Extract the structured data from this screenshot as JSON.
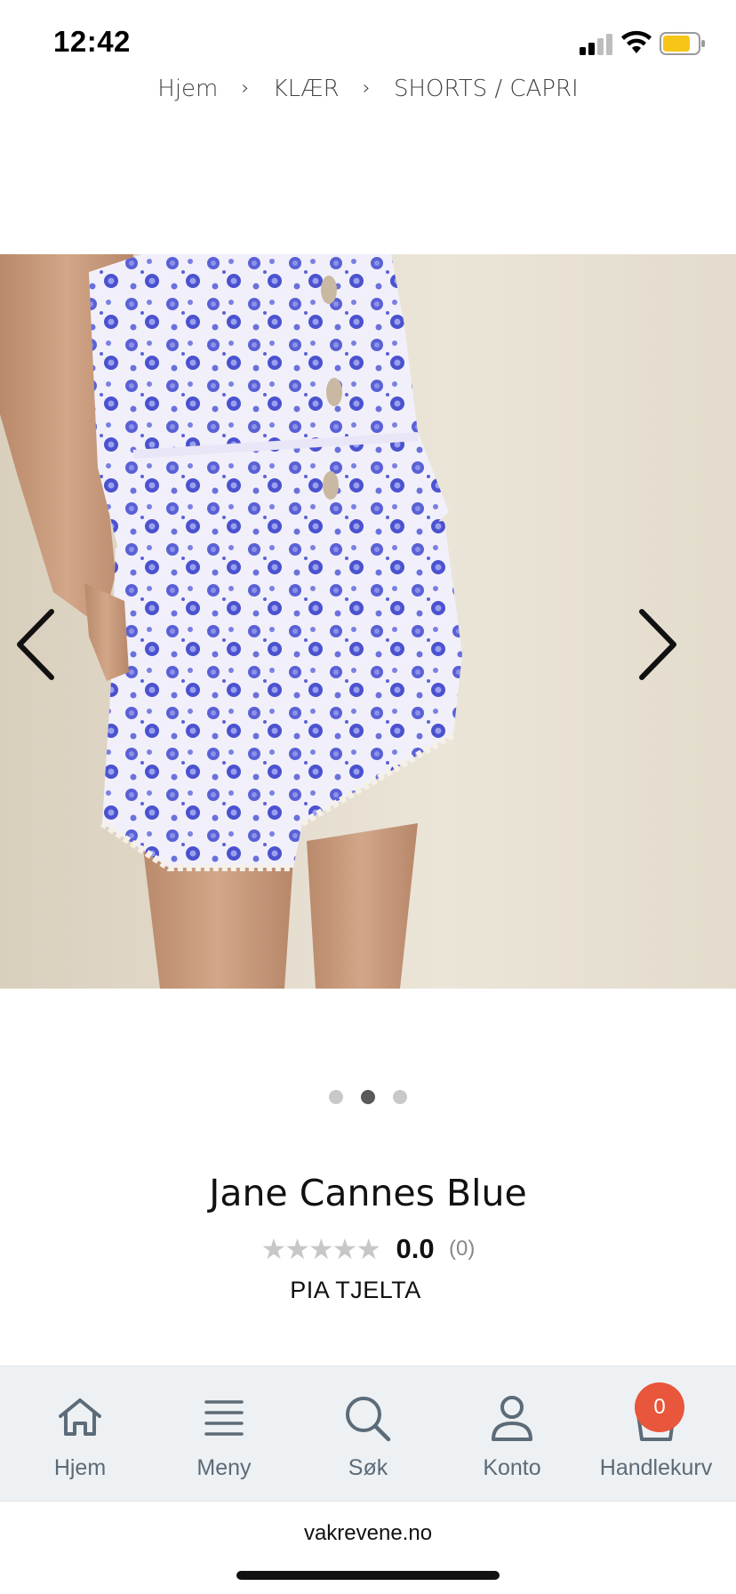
{
  "status": {
    "time": "12:42"
  },
  "breadcrumb": {
    "items": [
      "Hjem",
      "KLÆR",
      "SHORTS / CAPRI"
    ],
    "separator": "›"
  },
  "gallery": {
    "image_alt": "Model wearing blue floral print top and shorts",
    "slide_count": 3,
    "active_slide": 2
  },
  "product": {
    "title": "Jane Cannes Blue",
    "rating_value": "0.0",
    "rating_count": "(0)",
    "stars_total": 5,
    "stars_filled": 0,
    "brand": "PIA TJELTA"
  },
  "nav": {
    "items": [
      {
        "label": "Hjem",
        "icon": "home-icon"
      },
      {
        "label": "Meny",
        "icon": "menu-icon"
      },
      {
        "label": "Søk",
        "icon": "search-icon"
      },
      {
        "label": "Konto",
        "icon": "account-icon"
      },
      {
        "label": "Handlekurv",
        "icon": "cart-icon"
      }
    ],
    "cart_count": "0"
  },
  "browser": {
    "url": "vakrevene.no"
  },
  "colors": {
    "accent_badge": "#e8563b",
    "nav_bg": "#eef1f3",
    "nav_text": "#5c6b78",
    "battery": "#f5c518"
  }
}
